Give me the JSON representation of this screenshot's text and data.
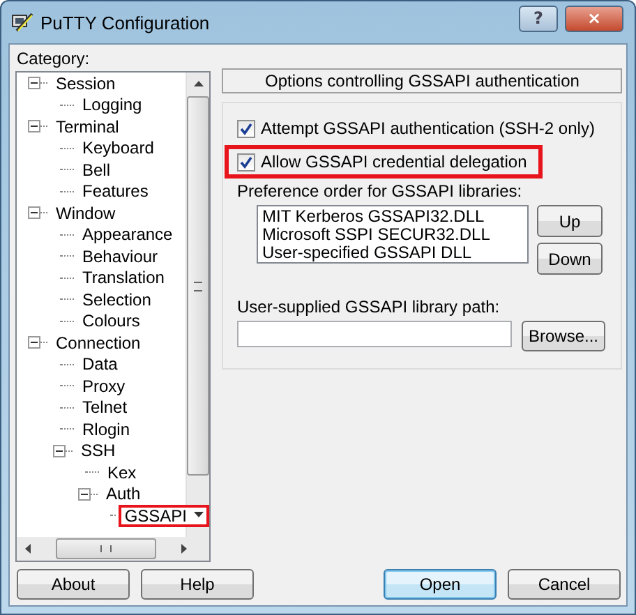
{
  "window": {
    "title": "PuTTY Configuration",
    "help_button": "?",
    "close_button": "×"
  },
  "category_label": "Category:",
  "tree": [
    {
      "label": "Session",
      "expanded": true,
      "highlighted": false,
      "children": [
        {
          "label": "Logging",
          "highlighted": false
        }
      ]
    },
    {
      "label": "Terminal",
      "expanded": true,
      "highlighted": false,
      "children": [
        {
          "label": "Keyboard",
          "highlighted": false
        },
        {
          "label": "Bell",
          "highlighted": false
        },
        {
          "label": "Features",
          "highlighted": false
        }
      ]
    },
    {
      "label": "Window",
      "expanded": true,
      "highlighted": false,
      "children": [
        {
          "label": "Appearance",
          "highlighted": false
        },
        {
          "label": "Behaviour",
          "highlighted": false
        },
        {
          "label": "Translation",
          "highlighted": false
        },
        {
          "label": "Selection",
          "highlighted": false
        },
        {
          "label": "Colours",
          "highlighted": false
        }
      ]
    },
    {
      "label": "Connection",
      "expanded": true,
      "highlighted": false,
      "children": [
        {
          "label": "Data",
          "highlighted": false
        },
        {
          "label": "Proxy",
          "highlighted": false
        },
        {
          "label": "Telnet",
          "highlighted": false
        },
        {
          "label": "Rlogin",
          "highlighted": false
        },
        {
          "label": "SSH",
          "expanded": true,
          "highlighted": false,
          "children": [
            {
              "label": "Kex",
              "highlighted": false
            },
            {
              "label": "Auth",
              "expanded": true,
              "highlighted": false,
              "children": [
                {
                  "label": "GSSAPI",
                  "highlighted": true
                }
              ]
            }
          ]
        }
      ]
    }
  ],
  "panel_title": "Options controlling GSSAPI authentication",
  "options": [
    {
      "label": "Attempt GSSAPI authentication (SSH-2 only)",
      "checked": true,
      "highlighted": false
    },
    {
      "label": "Allow GSSAPI credential delegation",
      "checked": true,
      "highlighted": true
    }
  ],
  "library_order": {
    "label": "Preference order for GSSAPI libraries:",
    "items": [
      "MIT Kerberos GSSAPI32.DLL",
      "Microsoft SSPI SECUR32.DLL",
      "User-specified GSSAPI DLL"
    ],
    "buttons": [
      "Up",
      "Down"
    ]
  },
  "library_path": {
    "label": "User-supplied GSSAPI library path:",
    "browse_button": "Browse..."
  },
  "buttons": [
    {
      "label": "About",
      "default": false
    },
    {
      "label": "Help",
      "default": false
    },
    {
      "label": "Open",
      "default": true
    },
    {
      "label": "Cancel",
      "default": false
    }
  ]
}
